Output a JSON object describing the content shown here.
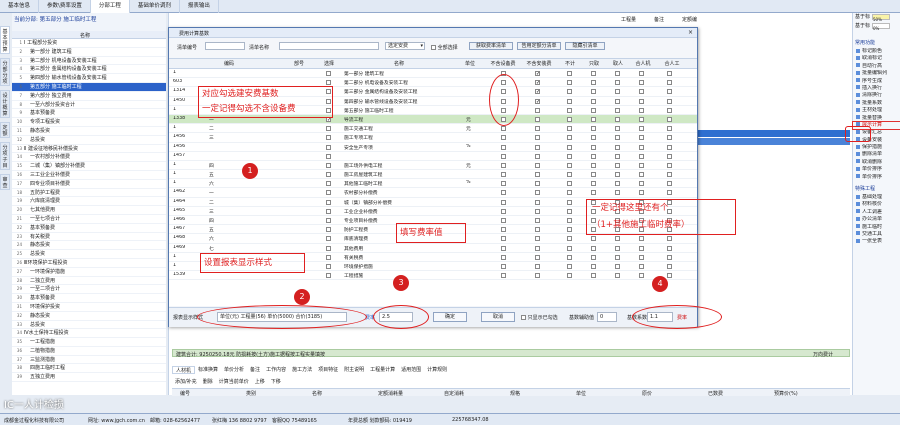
{
  "main_tabs": [
    "基本信息",
    "参数\\费率设置",
    "分部工程",
    "基础单价调剂",
    "报表输出"
  ],
  "active_main_tab": 2,
  "left_vtabs": [
    "基本预算",
    "分部分项",
    "设计概算",
    "定额",
    "分项子目",
    "审查"
  ],
  "tree_header_text": "当前分部: 第五部分 施工临时工程",
  "tree_col_name": "名称",
  "tree": [
    {
      "n": "1",
      "label": "Ⅰ 工程部分投资",
      "indent": 0
    },
    {
      "n": "2",
      "label": "第一部分 建筑工程",
      "indent": 2
    },
    {
      "n": "3",
      "label": "第二部分 机电设备及安装工程",
      "indent": 2
    },
    {
      "n": "4",
      "label": "第三部分 金属结构设备及安装工程",
      "indent": 2
    },
    {
      "n": "5",
      "label": "第四部分 输水管线设备及安装工程",
      "indent": 2
    },
    {
      "n": "6",
      "label": "第五部分 施工临时工程",
      "indent": 2,
      "selected": true
    },
    {
      "n": "7",
      "label": "第六部分 独立费用",
      "indent": 2
    },
    {
      "n": "8",
      "label": "一至六部分投资合计",
      "indent": 2
    },
    {
      "n": "9",
      "label": "基本预备费",
      "indent": 2
    },
    {
      "n": "10",
      "label": "专项工程投资",
      "indent": 2
    },
    {
      "n": "11",
      "label": "静态投资",
      "indent": 2
    },
    {
      "n": "12",
      "label": "总投资",
      "indent": 2
    },
    {
      "n": "13",
      "label": "Ⅱ 建设征地移民补偿投资",
      "indent": 0
    },
    {
      "n": "14",
      "label": "一农村部分补偿费",
      "indent": 2
    },
    {
      "n": "15",
      "label": "二城（集）镇部分补偿费",
      "indent": 2
    },
    {
      "n": "16",
      "label": "三工业企业补偿费",
      "indent": 2
    },
    {
      "n": "17",
      "label": "四专业项目补偿费",
      "indent": 2
    },
    {
      "n": "18",
      "label": "五防护工程费",
      "indent": 2
    },
    {
      "n": "19",
      "label": "六库底清理费",
      "indent": 2
    },
    {
      "n": "20",
      "label": "七其他费用",
      "indent": 2
    },
    {
      "n": "21",
      "label": "一至七项合计",
      "indent": 2
    },
    {
      "n": "22",
      "label": "基本预备费",
      "indent": 2
    },
    {
      "n": "23",
      "label": "有关税费",
      "indent": 2
    },
    {
      "n": "24",
      "label": "静态投资",
      "indent": 2
    },
    {
      "n": "25",
      "label": "总投资",
      "indent": 2
    },
    {
      "n": "26",
      "label": "Ⅲ环境保护工程投资",
      "indent": 0
    },
    {
      "n": "27",
      "label": "一环境保护措施",
      "indent": 2
    },
    {
      "n": "28",
      "label": "二独立费用",
      "indent": 2
    },
    {
      "n": "29",
      "label": "一至二项合计",
      "indent": 2
    },
    {
      "n": "30",
      "label": "基本预备费",
      "indent": 2
    },
    {
      "n": "31",
      "label": "环境保护投资",
      "indent": 2
    },
    {
      "n": "32",
      "label": "静态投资",
      "indent": 2
    },
    {
      "n": "33",
      "label": "总投资",
      "indent": 2
    },
    {
      "n": "34",
      "label": "Ⅳ水土保持工程投资",
      "indent": 0
    },
    {
      "n": "35",
      "label": "一工程措施",
      "indent": 2
    },
    {
      "n": "36",
      "label": "二植物措施",
      "indent": 2
    },
    {
      "n": "37",
      "label": "三监测措施",
      "indent": 2
    },
    {
      "n": "38",
      "label": "四施工临时工程",
      "indent": 2
    },
    {
      "n": "39",
      "label": "五独立费用",
      "indent": 2
    }
  ],
  "right_panel": {
    "rows": [
      {
        "label": "基于标",
        "value": "50%"
      },
      {
        "label": "基于标",
        "value": "0%"
      }
    ],
    "section1": "常用功能",
    "items": [
      "标记颜色",
      "取消标记",
      "自动行高",
      "批量编辑列",
      "序号生成",
      "插入换行",
      "清除换行",
      "批量系数",
      "主材处理",
      "批量替换",
      "展示计算",
      "设备汇总",
      "设备安装",
      "保护措施",
      "删除清单",
      "取消删除",
      "单价排序",
      "单价排序"
    ],
    "highlight_index": 10,
    "section2": "特殊工程",
    "items2": [
      "基础处理",
      "材料核价",
      "人工调差",
      "办公清单",
      "施工临时",
      "交通工具",
      "一张全表"
    ]
  },
  "dialog": {
    "title": "费用计算基数",
    "close": "×",
    "search": {
      "code_label": "清单编号",
      "name_label": "清单名称",
      "dropdown": "选定安费",
      "select_all_label": "全部选择",
      "btn1": "获取费率清单",
      "btn2": "告用定额分清单",
      "btn3": "隐藏引清单"
    },
    "columns": [
      "编码",
      "部号",
      "选择",
      "名称",
      "单位",
      "不含设备费",
      "不含安装费",
      "不计",
      "只取",
      "取人",
      "合人机",
      "合人工"
    ],
    "rows": [
      {
        "id": "1",
        "code": "",
        "partno": "",
        "checked": false,
        "name": "第一部分 建筑工程",
        "unit": "",
        "c1": false,
        "c2": true
      },
      {
        "id": "603",
        "code": "",
        "partno": "",
        "checked": false,
        "name": "第二部分 机电设备及安装工程",
        "unit": "",
        "c1": false,
        "c2": true
      },
      {
        "id": "1314",
        "code": "",
        "partno": "",
        "checked": false,
        "name": "第三部分 金属结构设备及安装工程",
        "unit": "",
        "c1": false,
        "c2": true
      },
      {
        "id": "1450",
        "code": "",
        "partno": "",
        "checked": false,
        "name": "第四部分 输水管线设备及安装工程",
        "unit": "",
        "c1": false,
        "c2": true
      },
      {
        "id": "1",
        "code": "",
        "partno": "",
        "checked": false,
        "name": "第五部分 施工临时工程",
        "unit": "",
        "c1": false,
        "c2": false
      },
      {
        "id": "1338",
        "code": "一",
        "partno": "",
        "checked": true,
        "name": "导流工程",
        "unit": "元",
        "c1": false,
        "c2": false,
        "hl": true
      },
      {
        "id": "1",
        "code": "二",
        "partno": "",
        "checked": false,
        "name": "施工交通工程",
        "unit": "元",
        "c1": false,
        "c2": false
      },
      {
        "id": "1456",
        "code": "三",
        "partno": "",
        "checked": false,
        "name": "施工专项工程",
        "unit": "",
        "c1": false,
        "c2": false
      },
      {
        "id": "1456",
        "code": "",
        "partno": "",
        "checked": false,
        "name": "安全生产专项",
        "unit": "%",
        "c1": false,
        "c2": false
      },
      {
        "id": "1457",
        "code": "",
        "partno": "",
        "checked": false,
        "name": "",
        "unit": "",
        "c1": false,
        "c2": false
      },
      {
        "id": "1",
        "code": "四",
        "partno": "",
        "checked": false,
        "name": "施工场外供电工程",
        "unit": "元",
        "c1": false,
        "c2": false
      },
      {
        "id": "1",
        "code": "五",
        "partno": "",
        "checked": false,
        "name": "施工房屋建筑工程",
        "unit": "",
        "c1": false,
        "c2": false
      },
      {
        "id": "1",
        "code": "六",
        "partno": "",
        "checked": false,
        "name": "其他施工临时工程",
        "unit": "%",
        "c1": false,
        "c2": false
      },
      {
        "id": "1462",
        "code": "一",
        "partno": "",
        "checked": false,
        "name": "农村部分补偿费",
        "unit": "",
        "c1": false,
        "c2": false
      },
      {
        "id": "1464",
        "code": "二",
        "partno": "",
        "checked": false,
        "name": "城（集）镇部分补偿费",
        "unit": "",
        "c1": false,
        "c2": false
      },
      {
        "id": "1465",
        "code": "三",
        "partno": "",
        "checked": false,
        "name": "工业企业补偿费",
        "unit": "",
        "c1": false,
        "c2": false
      },
      {
        "id": "1466",
        "code": "四",
        "partno": "",
        "checked": false,
        "name": "专业项目补偿费",
        "unit": "",
        "c1": false,
        "c2": false
      },
      {
        "id": "1467",
        "code": "五",
        "partno": "",
        "checked": false,
        "name": "防护工程费",
        "unit": "",
        "c1": false,
        "c2": false
      },
      {
        "id": "1468",
        "code": "六",
        "partno": "",
        "checked": false,
        "name": "库底清理费",
        "unit": "",
        "c1": false,
        "c2": false
      },
      {
        "id": "1469",
        "code": "七",
        "partno": "",
        "checked": false,
        "name": "其他费用",
        "unit": "",
        "c1": false,
        "c2": false
      },
      {
        "id": "1",
        "code": "",
        "partno": "",
        "checked": false,
        "name": "有关税费",
        "unit": "",
        "c1": false,
        "c2": false
      },
      {
        "id": "1",
        "code": "",
        "partno": "",
        "checked": false,
        "name": "环境保护措施",
        "unit": "",
        "c1": false,
        "c2": false
      },
      {
        "id": "1539",
        "code": "",
        "partno": "",
        "checked": false,
        "name": "工程措施",
        "unit": "",
        "c1": false,
        "c2": false
      }
    ],
    "footer": {
      "style_label": "报表显示样式",
      "style_value": "单位(元) 工程量(56) 单价(5000) 合价(3185)",
      "rate_label": "费率",
      "rate_value": "2.5",
      "ok": "确定",
      "cancel": "取消",
      "only_selected": "只显示已勾选",
      "base_label": "基数辅助值",
      "base_value": "0",
      "coef_label": "基数系数",
      "coef_value": "1.1",
      "suffix": "费率"
    }
  },
  "annotations": {
    "a1": "对应勾选建安费基数\n一定记得勾选不含设备费",
    "a2": "设置报表显示样式",
    "a3": "填写费率值",
    "a4": "一定记得这里还有个\n（1+其他施工临时费率）",
    "n1": "1",
    "n2": "2",
    "n3": "3",
    "n4": "4"
  },
  "content_top_labels": [
    "工程量",
    "备注",
    "定额编"
  ],
  "lower": {
    "summary": "建筑合计: 9250250.18元 防损耗按(土方)施工据程按工程实量填按",
    "formula_label": "万向费计",
    "tabs": [
      "人材机",
      "标准换算",
      "单价分析",
      "备注",
      "工作内容",
      "施工方法",
      "项目特征",
      "附主说明",
      "工程量计算",
      "适用范围",
      "计算规则"
    ],
    "toolbar": [
      "添加/补充",
      "删除",
      "计算当前单价",
      "上移",
      "下移"
    ],
    "cols": [
      "编号",
      "类别",
      "名称",
      "定额消耗量",
      "自定消耗",
      "规格",
      "单位",
      "原价",
      "已数费",
      "预算价(%)"
    ]
  },
  "status": {
    "company": "成都金过程化科技有限公司",
    "web": "网址: www.jgch.com.cn",
    "phone": "邮箱: 028-62562477",
    "contact": "张红梅 136 8802 9797",
    "qq": "客服QQ 75489165",
    "year": "年费总额 划款额码: 019419",
    "total": "225768347.08"
  },
  "watermark": "IC一人计检损"
}
